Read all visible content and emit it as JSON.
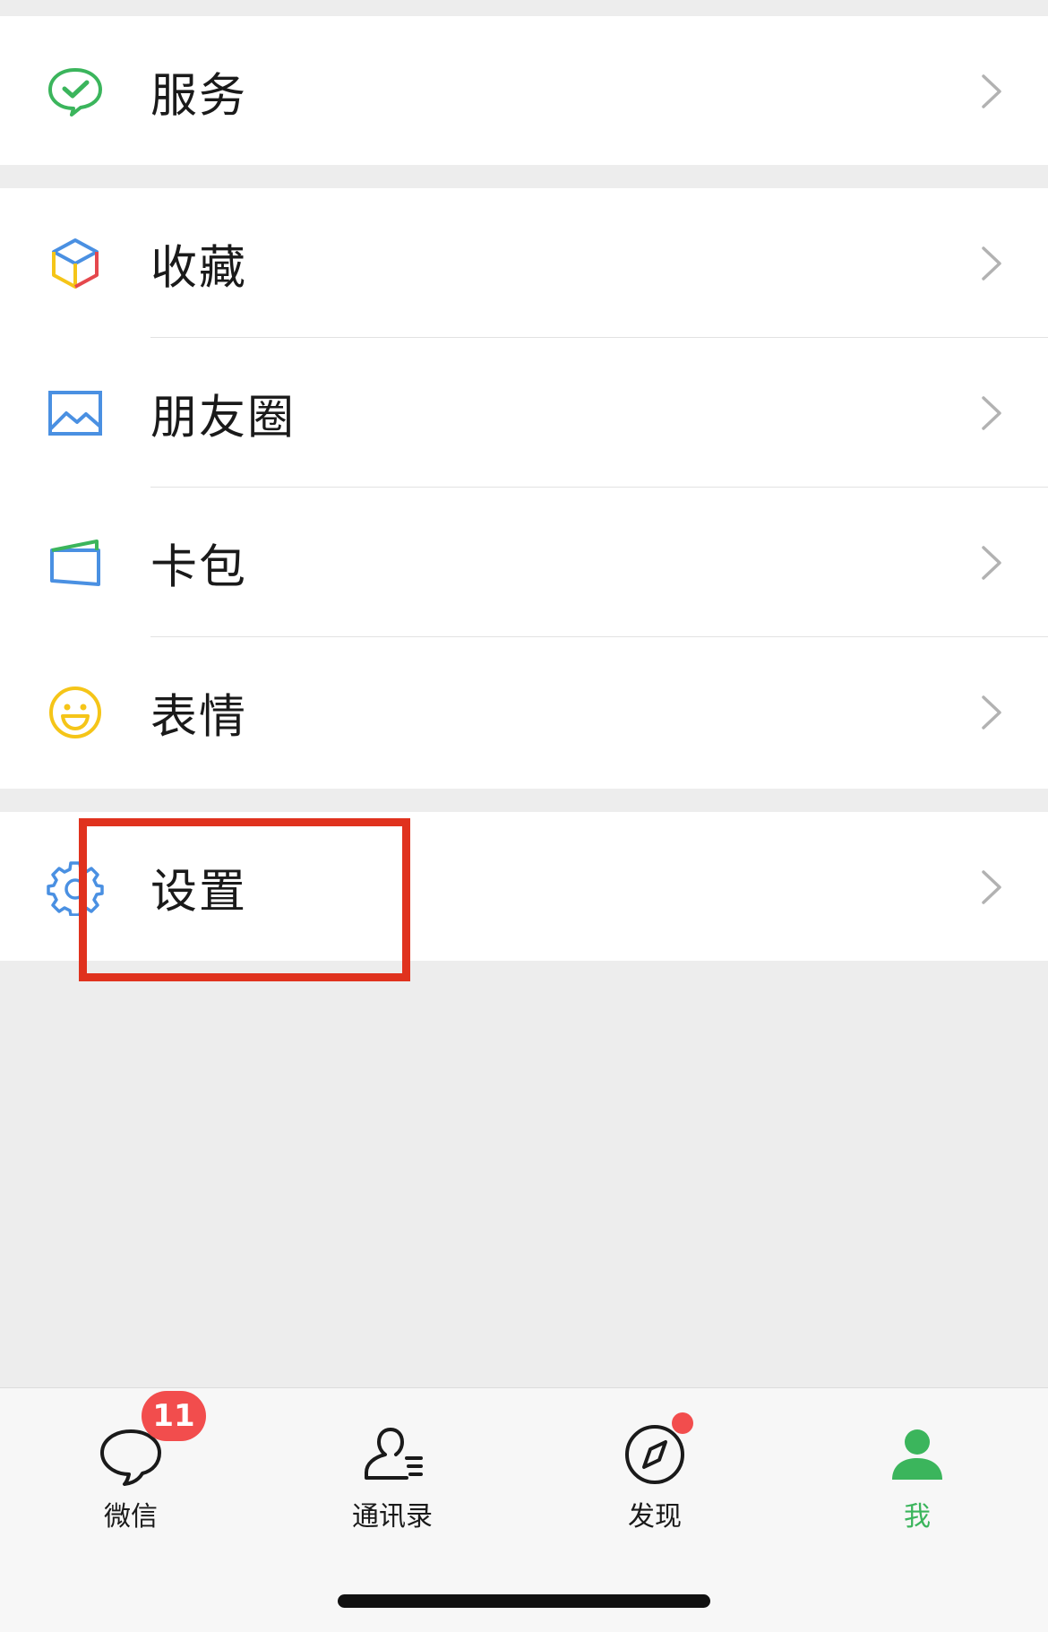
{
  "menu": {
    "groups": [
      {
        "items": [
          {
            "label": "服务",
            "icon": "wechat-pay-check-icon",
            "color": "#3bb55c"
          }
        ]
      },
      {
        "items": [
          {
            "label": "收藏",
            "icon": "cube-icon",
            "color": "#4a90e2"
          },
          {
            "label": "朋友圈",
            "icon": "photo-album-icon",
            "color": "#4a90e2"
          },
          {
            "label": "卡包",
            "icon": "wallet-card-icon",
            "color": "#4a90e2"
          },
          {
            "label": "表情",
            "icon": "smiley-face-icon",
            "color": "#f5c518"
          }
        ]
      },
      {
        "items": [
          {
            "label": "设置",
            "icon": "gear-icon",
            "color": "#4a90e2",
            "highlighted": true
          }
        ]
      }
    ]
  },
  "annotation": {
    "highlight_color": "#e0321e"
  },
  "tabbar": {
    "tabs": [
      {
        "label": "微信",
        "icon": "chat-bubble-icon",
        "badge": "11"
      },
      {
        "label": "通讯录",
        "icon": "contacts-icon"
      },
      {
        "label": "发现",
        "icon": "compass-icon",
        "red_dot": true
      },
      {
        "label": "我",
        "icon": "person-icon",
        "active": true
      }
    ],
    "active_color": "#3bb55c",
    "badge_color": "#f24d4d"
  }
}
